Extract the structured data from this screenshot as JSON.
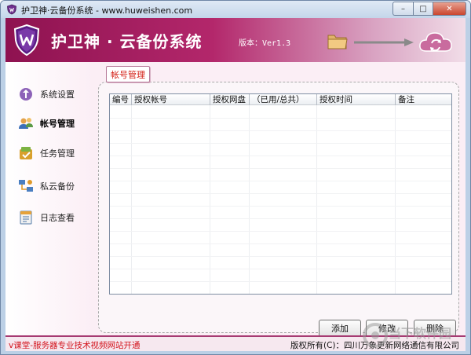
{
  "window": {
    "title": "护卫神·云备份系统 - www.huweishen.com",
    "controls": {
      "minimize": "–",
      "maximize": "□",
      "close": "✕"
    }
  },
  "header": {
    "app_title": "护卫神 · 云备份系统",
    "version": "版本：Ver1.3",
    "colors": {
      "banner_start": "#8e1250",
      "banner_end": "#f1dde8"
    }
  },
  "sidebar": {
    "items": [
      {
        "label": "系统设置",
        "icon": "settings-icon",
        "active": false
      },
      {
        "label": "帐号管理",
        "icon": "users-icon",
        "active": true
      },
      {
        "label": "任务管理",
        "icon": "tasks-icon",
        "active": false
      },
      {
        "label": "私云备份",
        "icon": "network-icon",
        "active": false
      },
      {
        "label": "日志查看",
        "icon": "log-icon",
        "active": false
      }
    ]
  },
  "main": {
    "tab_label": "帐号管理",
    "table": {
      "columns": [
        "编号",
        "授权帐号",
        "授权网盘",
        "（已用/总共）",
        "授权时间",
        "备注"
      ],
      "rows": []
    },
    "buttons": {
      "add": "添加",
      "edit": "修改",
      "delete": "删除"
    }
  },
  "status": {
    "left": "v课堂-服务器专业技术视频网站开通",
    "right": "版权所有(C)：四川万象更新网络通信有限公司"
  },
  "watermark": {
    "text": "当下软件园"
  }
}
